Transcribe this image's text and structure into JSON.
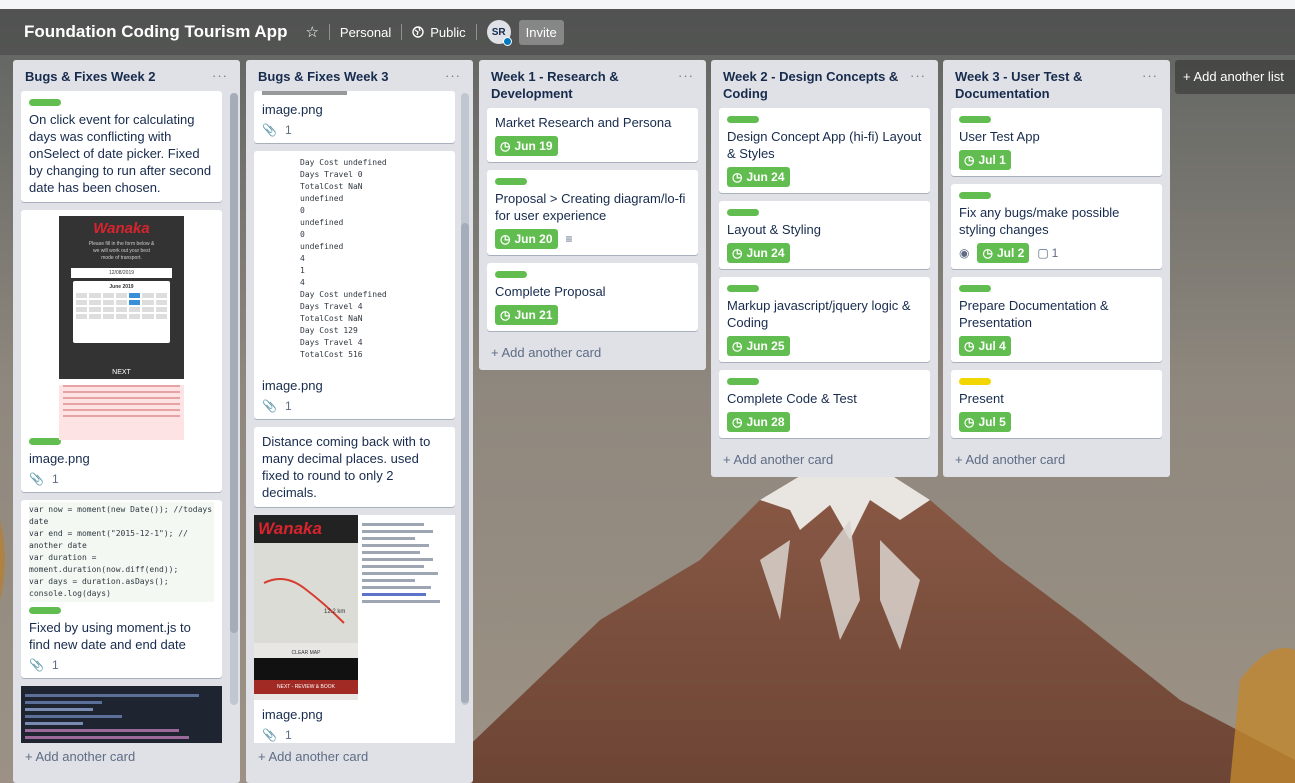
{
  "board": {
    "title": "Foundation Coding Tourism App",
    "visibility_team": "Personal",
    "visibility": "Public",
    "avatar_initials": "SR",
    "invite_label": "Invite",
    "add_list_label": "+ Add another list"
  },
  "colors": {
    "green_label": "#61bd4f",
    "yellow_label": "#f2d600",
    "due_green": "#61bd4f"
  },
  "icons": {
    "star": "star-icon",
    "public": "globe-icon",
    "clock": "clock-icon",
    "attachment": "paperclip-icon",
    "description": "description-icon",
    "watch": "eye-icon",
    "comment": "comment-icon"
  },
  "add_card_label": "+ Add another card",
  "lists": [
    {
      "title": "Bugs & Fixes Week 2",
      "cards": [
        {
          "text": "On click event for calculating days was conflicting with onSelect of date picker. Fixed by changing to run after second date has been chosen."
        },
        {
          "image_title": "Wanaka",
          "image_lines": [
            "Please fill in the form below &",
            "we will work out your best",
            "mode of transport."
          ],
          "image_date": "12/08/2019",
          "image_month": "June 2019",
          "image_next": "NEXT",
          "text": "image.png",
          "attachments": "1"
        },
        {
          "code": [
            "var now = moment(new Date()); //todays date",
            "var end = moment(\"2015-12-1\"); // another date",
            "var duration = moment.duration(now.diff(end));",
            "var days = duration.asDays();",
            "console.log(days)"
          ],
          "text": "Fixed by using moment.js to find new date and end date",
          "attachments": "1"
        }
      ]
    },
    {
      "title": "Bugs & Fixes Week 3",
      "cards": [
        {
          "text": "image.png",
          "attachments": "1"
        },
        {
          "console": [
            "Day Cost undefined",
            "Days Travel 0",
            "TotalCost NaN",
            "undefined",
            "0",
            "undefined",
            "0",
            "undefined",
            "4",
            "1",
            "4",
            "Day Cost undefined",
            "Days Travel 4",
            "TotalCost NaN",
            "Day Cost 129",
            "Days Travel 4",
            "TotalCost 516"
          ],
          "text": "image.png",
          "attachments": "1"
        },
        {
          "text": "Distance coming back with to many decimal places. used fixed to round to only 2 decimals."
        },
        {
          "image_title": "Wanaka",
          "image_clear": "CLEAR MAP",
          "image_next": "NEXT - REVIEW & BOOK",
          "image_distance": "12.2 km",
          "text": "image.png",
          "attachments": "1"
        }
      ]
    },
    {
      "title": "Week 1 - Research & Development",
      "cards": [
        {
          "text": "Market Research and Persona",
          "due": "Jun 19"
        },
        {
          "text": "Proposal > Creating diagram/lo-fi for user experience",
          "due": "Jun 20"
        },
        {
          "text": "Complete Proposal",
          "due": "Jun 21"
        }
      ]
    },
    {
      "title": "Week 2 - Design Concepts & Coding",
      "cards": [
        {
          "text": "Design Concept App (hi-fi) Layout & Styles",
          "due": "Jun 24"
        },
        {
          "text": "Layout & Styling",
          "due": "Jun 24"
        },
        {
          "text": "Markup javascript/jquery logic & Coding",
          "due": "Jun 25"
        },
        {
          "text": "Complete Code & Test",
          "due": "Jun 28"
        }
      ]
    },
    {
      "title": "Week 3 - User Test & Documentation",
      "cards": [
        {
          "text": "User Test App",
          "due": "Jul 1"
        },
        {
          "text": "Fix any bugs/make possible styling changes",
          "due": "Jul 2",
          "comments": "1"
        },
        {
          "text": "Prepare Documentation & Presentation",
          "due": "Jul 4"
        },
        {
          "text": "Present",
          "due": "Jul 5"
        }
      ]
    }
  ]
}
